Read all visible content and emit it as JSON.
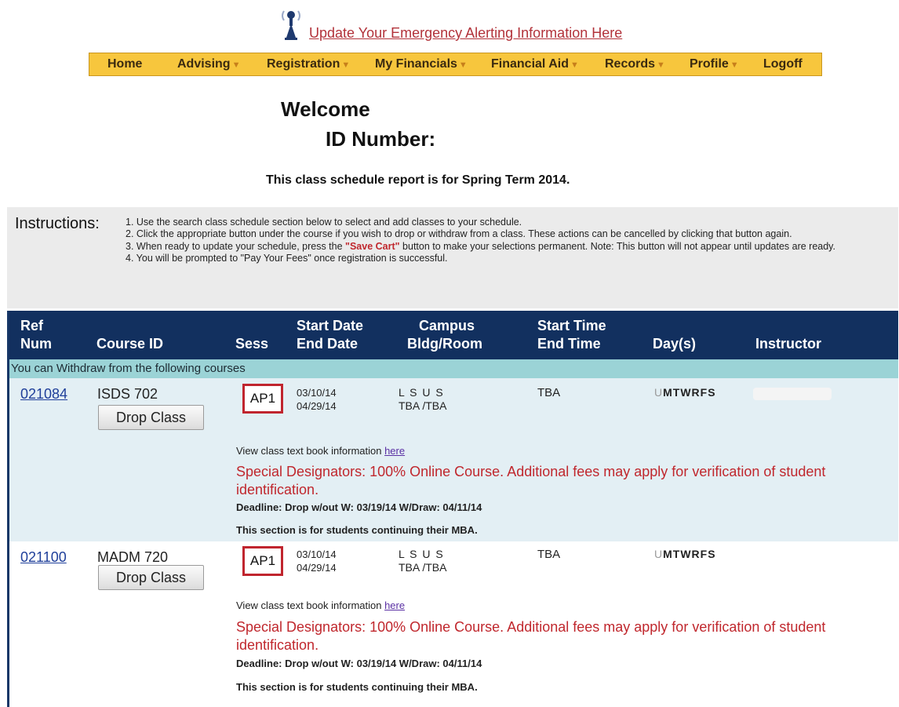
{
  "alert": {
    "icon": "alert-tower-icon",
    "link_text": "Update Your Emergency Alerting Information Here"
  },
  "nav": [
    {
      "label": "Home",
      "dropdown": false
    },
    {
      "label": "Advising",
      "dropdown": true
    },
    {
      "label": "Registration",
      "dropdown": true
    },
    {
      "label": "My Financials",
      "dropdown": true
    },
    {
      "label": "Financial Aid",
      "dropdown": true
    },
    {
      "label": "Records",
      "dropdown": true
    },
    {
      "label": "Profile",
      "dropdown": true
    },
    {
      "label": "Logoff",
      "dropdown": false
    }
  ],
  "welcome": "Welcome",
  "id_number_label": "ID Number:",
  "term_text": "This class schedule report is for Spring Term 2014.",
  "instructions": {
    "title": "Instructions:",
    "line1": "1. Use the search class schedule section below to select and add classes to your schedule.",
    "line2": "2. Click the appropriate button under the course if you wish to drop or withdraw from a class. These actions can be cancelled by clicking that button again.",
    "line3_pre": "3. When ready to update your schedule, press the ",
    "line3_button": "\"Save Cart\"",
    "line3_post": " button to make your selections permanent. Note: This button will not appear until updates are ready.",
    "line4": "4. You will be prompted to \"Pay Your Fees\" once registration is successful."
  },
  "table": {
    "headers": {
      "ref": "Ref Num",
      "course": "Course ID",
      "sess": "Sess",
      "dates": "Start Date End Date",
      "campus": "Campus Bldg/Room",
      "time": "Start Time End Time",
      "days": "Day(s)",
      "instructor": "Instructor"
    },
    "ref_line1": "Ref",
    "ref_line2": "Num",
    "dates_line1": "Start Date",
    "dates_line2": "End Date",
    "campus_line1": "Campus",
    "campus_line2": "Bldg/Room",
    "time_line1": "Start Time",
    "time_line2": "End Time",
    "withdraw_text": "You can Withdraw from the following courses",
    "courses": [
      {
        "ref": "021084",
        "course_id": "ISDS 702",
        "drop_label": "Drop Class",
        "sess": "AP1",
        "start_date": "03/10/14",
        "end_date": "04/29/14",
        "campus": "L S U S",
        "bldg_room": "TBA /TBA",
        "time": "TBA",
        "days_prefix": "U",
        "days": "MTWRFS",
        "textbook_text": "View class text book information ",
        "textbook_link": "here",
        "designators": "Special Designators: 100% Online Course. Additional fees may apply for verification of student identification.",
        "deadline": "Deadline: Drop w/out W: 03/19/14 W/Draw: 04/11/14",
        "note": "This section is for students continuing their MBA."
      },
      {
        "ref": "021100",
        "course_id": "MADM 720",
        "drop_label": "Drop Class",
        "sess": "AP1",
        "start_date": "03/10/14",
        "end_date": "04/29/14",
        "campus": "L S U S",
        "bldg_room": "TBA /TBA",
        "time": "TBA",
        "days_prefix": "U",
        "days": "MTWRFS",
        "textbook_text": "View class text book information ",
        "textbook_link": "here",
        "designators": "Special Designators: 100% Online Course. Additional fees may apply for verification of student identification.",
        "deadline": "Deadline: Drop w/out W: 03/19/14 W/Draw: 04/11/14",
        "note": "This section is for students continuing their MBA."
      }
    ]
  },
  "colors": {
    "nav_bg": "#f7c63d",
    "header_bg": "#12305f",
    "withdraw_bg": "#9bd3d6",
    "accent_red": "#c0272d",
    "link_blue": "#1f3f9a"
  }
}
